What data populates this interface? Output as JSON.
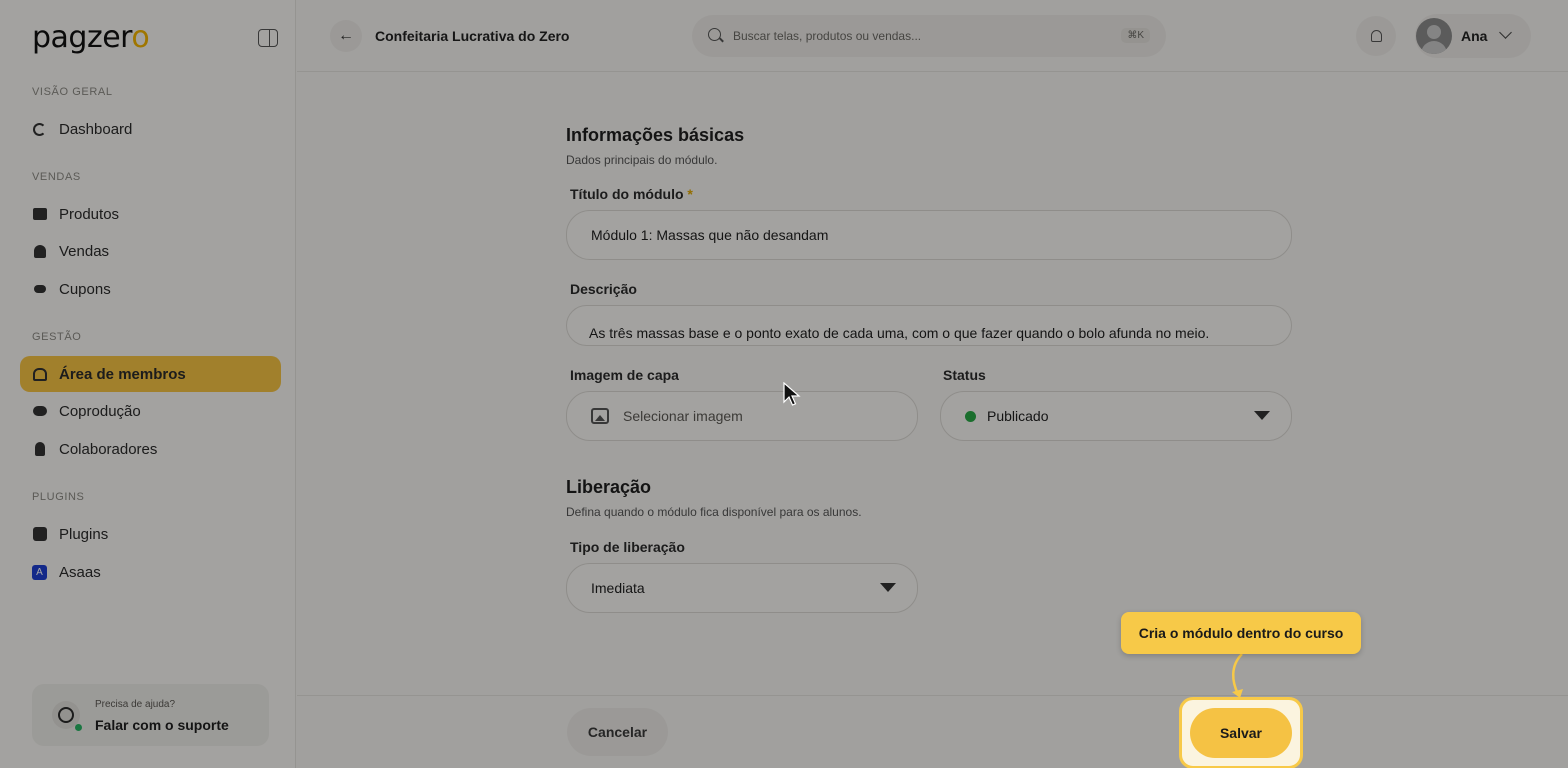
{
  "brand": {
    "logo_main": "pagzer",
    "logo_accent": "o"
  },
  "sidebar": {
    "sections": [
      {
        "title": "VISÃO GERAL",
        "items": [
          {
            "label": "Dashboard",
            "icon": "dashboard-icon"
          }
        ]
      },
      {
        "title": "VENDAS",
        "items": [
          {
            "label": "Produtos",
            "icon": "products-icon"
          },
          {
            "label": "Vendas",
            "icon": "sales-icon"
          },
          {
            "label": "Cupons",
            "icon": "coupon-icon"
          }
        ]
      },
      {
        "title": "GESTÃO",
        "items": [
          {
            "label": "Área de membros",
            "icon": "members-icon",
            "active": true
          },
          {
            "label": "Coprodução",
            "icon": "handshake-icon"
          },
          {
            "label": "Colaboradores",
            "icon": "user-icon"
          }
        ]
      },
      {
        "title": "PLUGINS",
        "items": [
          {
            "label": "Plugins",
            "icon": "puzzle-icon"
          },
          {
            "label": "Asaas",
            "icon": "asaas-icon",
            "icon_text": "A"
          }
        ]
      }
    ],
    "support": {
      "caption": "Precisa de ajuda?",
      "label": "Falar com o suporte"
    }
  },
  "header": {
    "title": "Confeitaria Lucrativa do Zero",
    "search_placeholder": "Buscar telas, produtos ou vendas...",
    "search_shortcut": "⌘K",
    "user_name": "Ana"
  },
  "form": {
    "basic": {
      "heading": "Informações básicas",
      "subheading": "Dados principais do módulo.",
      "title_label": "Título do módulo",
      "required_mark": "*",
      "title_value": "Módulo 1: Massas que não desandam",
      "description_label": "Descrição",
      "description_value": "As três massas base e o ponto exato de cada uma, com o que fazer quando o bolo afunda no meio.",
      "cover_label": "Imagem de capa",
      "cover_placeholder": "Selecionar imagem",
      "status_label": "Status",
      "status_value": "Publicado"
    },
    "release": {
      "heading": "Liberação",
      "subheading": "Defina quando o módulo fica disponível para os alunos.",
      "type_label": "Tipo de liberação",
      "type_value": "Imediata"
    }
  },
  "footer": {
    "cancel_label": "Cancelar",
    "save_label": "Salvar"
  },
  "tooltip": {
    "text": "Cria o módulo dentro do curso"
  },
  "colors": {
    "accent": "#f5c244",
    "status_published": "#28a745",
    "asaas": "#1d3fd1"
  }
}
